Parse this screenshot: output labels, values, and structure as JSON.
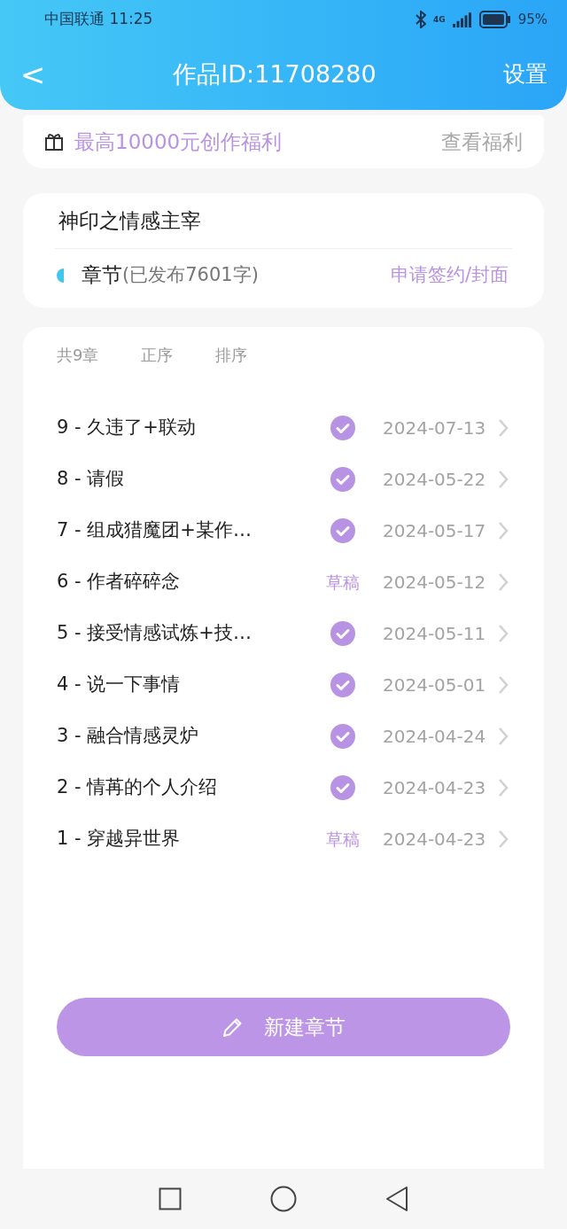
{
  "status_bar": {
    "carrier_time": "中国联通 11:25",
    "network": "4G",
    "battery": "95%"
  },
  "header": {
    "back": "<",
    "title": "作品ID:11708280",
    "action": "设置"
  },
  "promo": {
    "text": "最高10000元创作福利",
    "link": "查看福利"
  },
  "work": {
    "title": "神印之情感主宰",
    "chapters_label": "章节",
    "published_info": "(已发布7601字)",
    "action": "申请签约/封面"
  },
  "chapter_list": {
    "count": "共9章",
    "order": "正序",
    "sort": "排序",
    "chapters": [
      {
        "title": "9 - 久违了+联动",
        "kind": "published",
        "date": "2024-07-13"
      },
      {
        "title": "8 - 请假",
        "kind": "published",
        "date": "2024-05-22"
      },
      {
        "title": "7 - 组成猎魔团+某作…",
        "kind": "published",
        "date": "2024-05-17"
      },
      {
        "title": "6 - 作者碎碎念",
        "kind": "draft",
        "status": "草稿",
        "date": "2024-05-12"
      },
      {
        "title": "5 - 接受情感试炼+技…",
        "kind": "published",
        "date": "2024-05-11"
      },
      {
        "title": "4 - 说一下事情",
        "kind": "published",
        "date": "2024-05-01"
      },
      {
        "title": "3 - 融合情感灵炉",
        "kind": "published",
        "date": "2024-04-24"
      },
      {
        "title": "2 - 情苒的个人介绍",
        "kind": "published",
        "date": "2024-04-23"
      },
      {
        "title": "1 - 穿越异世界",
        "kind": "draft",
        "status": "草稿",
        "date": "2024-04-23"
      }
    ],
    "new_button": "新建章节"
  }
}
